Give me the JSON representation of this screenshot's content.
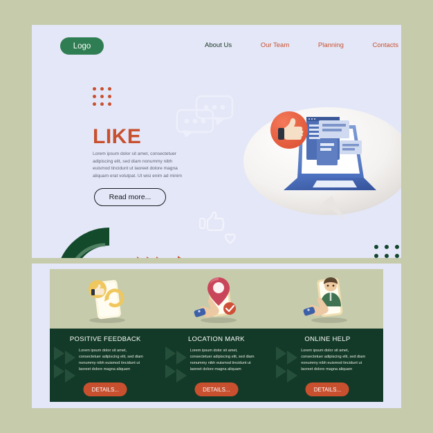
{
  "page": {
    "background_color": "#c5cbab",
    "panel_color": "#e4e7f7",
    "accent_orange": "#c8502f",
    "accent_green": "#2f7d52",
    "dark_green": "#133a28",
    "sage": "#c5cbab"
  },
  "hero": {
    "logo_label": "Logo",
    "nav": [
      {
        "label": "About Us",
        "color": "#16321f"
      },
      {
        "label": "Our Team",
        "color": "#c8502f"
      },
      {
        "label": "Planning",
        "color": "#c8502f"
      },
      {
        "label": "Contacts",
        "color": "#c8502f"
      }
    ],
    "title": "LIKE",
    "paragraph": "Lorem ipsum dolor sit amet, consectetuer adipiscing elit, sed diam nonummy nibh euismod tincidunt ut laoreet dolore magna aliquam erat volutpat. Ut wisi enim ad minim",
    "cta_label": "Read more...",
    "illustration_name": "laptop-in-speech-bubble-with-thumbs-up"
  },
  "cards": [
    {
      "title": "POSITIVE FEEDBACK",
      "text": "Lorem ipsum dolor sit amet, consectetuer adipiscing elit, sed diam nonummy nibh euismod tincidunt ut laoreet dolore magna aliquam",
      "button_label": "DETAILS...",
      "illustration_name": "phone-thumbs-up-refresh"
    },
    {
      "title": "LOCATION MARK",
      "text": "Lorem ipsum dolor sit amet, consectetuer adipiscing elit, sed diam nonummy nibh euismod tincidunt ut laoreet dolore magna aliquam",
      "button_label": "DETAILS...",
      "illustration_name": "phone-location-pin-hand-check"
    },
    {
      "title": "ONLINE HELP",
      "text": "Lorem ipsum dolor sit amet, consectetuer adipiscing elit, sed diam nonummy nibh euismod tincidunt ut laoreet dolore magna aliquam",
      "button_label": "DETAILS...",
      "illustration_name": "phone-person-hand-support"
    }
  ]
}
